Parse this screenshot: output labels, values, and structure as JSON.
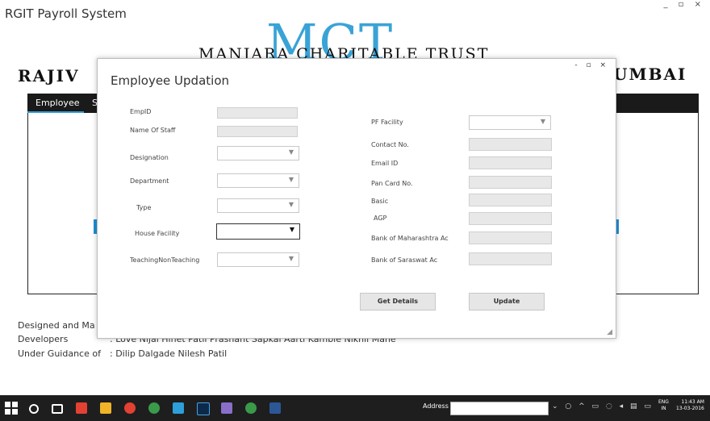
{
  "app": {
    "title": "RGIT Payroll System",
    "window_controls": "_ ▫ ×"
  },
  "banner": {
    "logo_text": "MCT",
    "trust_name": "MANJARA CHARITABLE TRUST",
    "college_left": "RAJIV",
    "college_right": "UMBAI"
  },
  "menu": {
    "employee": "Employee",
    "second_partial": "S"
  },
  "credits": {
    "designed_partial": "Designed and Ma",
    "developers_label": "Developers",
    "developers_value": ": Love Nijai   Hinet Patil   Prashant Sapkal   Aarti Kamble  Nikhil Mane",
    "guidance_label": "Under Guidance of",
    "guidance_value": ":  Dilip Dalgade   Nilesh Patil"
  },
  "dialog": {
    "title": "Employee Updation",
    "controls": "- ▫ ×",
    "left_fields": {
      "empid": "EmpID",
      "name_of_staff": "Name Of Staff",
      "designation": "Designation",
      "department": "Department",
      "type": "Type",
      "house_facility": "House Facility",
      "teaching": "TeachingNonTeaching"
    },
    "right_fields": {
      "pf_facility": "PF Facility",
      "contact": "Contact No.",
      "email": "Email ID",
      "pan": "Pan Card No.",
      "basic": "Basic",
      "agp": "AGP",
      "bank_maharashtra": "Bank of Maharashtra Ac",
      "bank_saraswat": "Bank of Saraswat Ac"
    },
    "buttons": {
      "get_details": "Get Details",
      "update": "Update"
    }
  },
  "taskbar": {
    "address_label": "Address",
    "tray_icons": "⌄ ○ ^ ▭ ◌ ◂ ▤ ▭",
    "lang_top": "ENG",
    "lang_bottom": "IN",
    "time": "11:43 AM",
    "date": "13-03-2016",
    "colors": {
      "explorer": "#f0b429",
      "chrome": "#e34133",
      "edge": "#2d9fd9",
      "word": "#2b5797",
      "photoshop": "#0b2a4a",
      "green_app": "#3a9a4a",
      "purple_app": "#8a6fc9"
    }
  }
}
